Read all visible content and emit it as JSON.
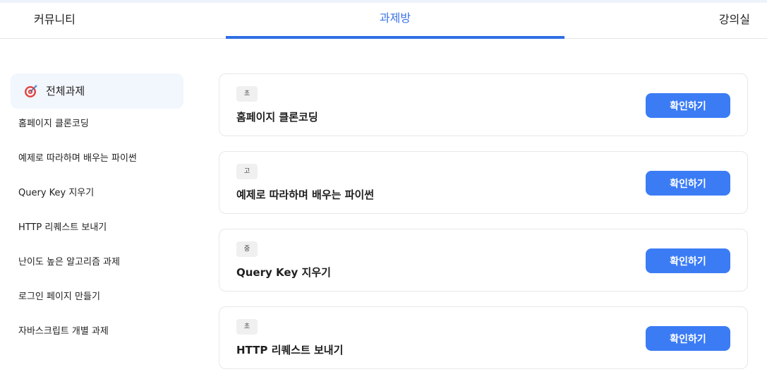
{
  "nav": {
    "left": "커뮤니티",
    "center": "과제방",
    "right": "강의실"
  },
  "sidebar": {
    "active_label": "전체과제",
    "active_icon": "target-icon",
    "items": [
      {
        "label": "홈페이지 클론코딩"
      },
      {
        "label": "예제로 따라하며 배우는 파이썬"
      },
      {
        "label": "Query Key 지우기"
      },
      {
        "label": "HTTP 리퀘스트 보내기"
      },
      {
        "label": "난이도 높은 알고리즘 과제"
      },
      {
        "label": "로그인 페이지 만들기"
      },
      {
        "label": "자바스크립트 개별 과제"
      }
    ]
  },
  "cards": [
    {
      "level": "초",
      "title": "홈페이지 클론코딩",
      "button": "확인하기"
    },
    {
      "level": "고",
      "title": "예제로 따라하며 배우는 파이썬",
      "button": "확인하기"
    },
    {
      "level": "중",
      "title": "Query Key 지우기",
      "button": "확인하기"
    },
    {
      "level": "초",
      "title": "HTTP 리퀘스트 보내기",
      "button": "확인하기"
    }
  ],
  "colors": {
    "accent": "#2f6fe4",
    "button": "#3b7cf5",
    "active_bg": "#f2f6fd"
  }
}
